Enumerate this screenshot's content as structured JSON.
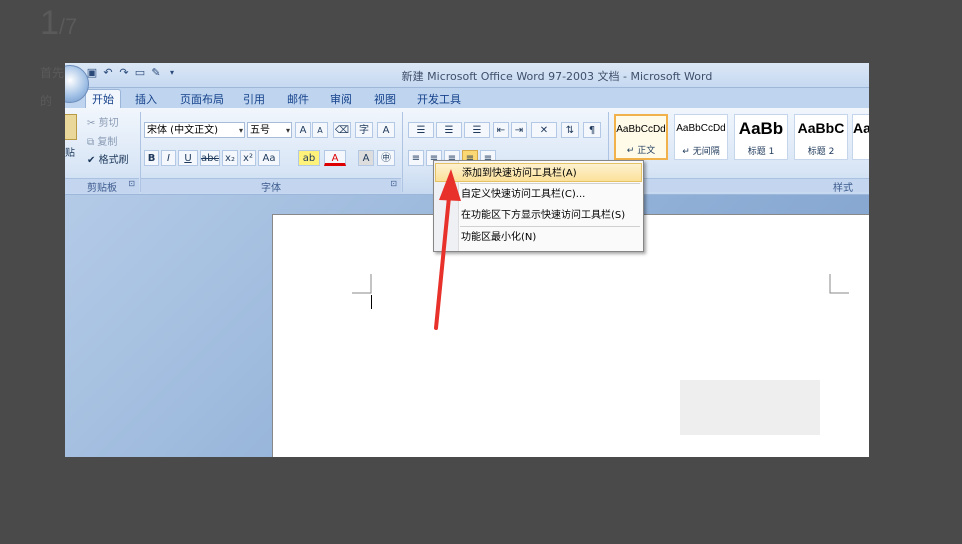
{
  "viewer": {
    "current": "1",
    "total": "/7",
    "bg_line1": "首先",
    "bg_line2": "的"
  },
  "window": {
    "title": "新建 Microsoft Office Word 97-2003 文档 - Microsoft Word"
  },
  "qat_icons": [
    "save-icon",
    "undo-icon",
    "redo-icon",
    "print-preview-icon",
    "customize-icon"
  ],
  "tabs": [
    {
      "label": "开始",
      "active": true
    },
    {
      "label": "插入"
    },
    {
      "label": "页面布局"
    },
    {
      "label": "引用"
    },
    {
      "label": "邮件"
    },
    {
      "label": "审阅"
    },
    {
      "label": "视图"
    },
    {
      "label": "开发工具"
    }
  ],
  "clipboard": {
    "cut": "剪切",
    "copy": "复制",
    "format_painter": "格式刷",
    "paste_partial": "贴",
    "label": "剪贴板"
  },
  "font": {
    "name": "宋体 (中文正文)",
    "size": "五号",
    "label": "字体"
  },
  "styles": {
    "label": "样式",
    "items": [
      {
        "preview": "AaBbCcDd",
        "name": "↵ 正文"
      },
      {
        "preview": "AaBbCcDd",
        "name": "↵ 无间隔"
      },
      {
        "preview": "AaBb",
        "name": "标题 1"
      },
      {
        "preview": "AaBbC",
        "name": "标题 2"
      },
      {
        "preview": "Aa",
        "name": ""
      }
    ]
  },
  "context_menu": {
    "items": [
      "添加到快速访问工具栏(A)",
      "自定义快速访问工具栏(C)...",
      "在功能区下方显示快速访问工具栏(S)",
      "功能区最小化(N)"
    ]
  },
  "colors": {
    "accent_arrow": "#e8312a",
    "highlight": "#fbe19a"
  }
}
